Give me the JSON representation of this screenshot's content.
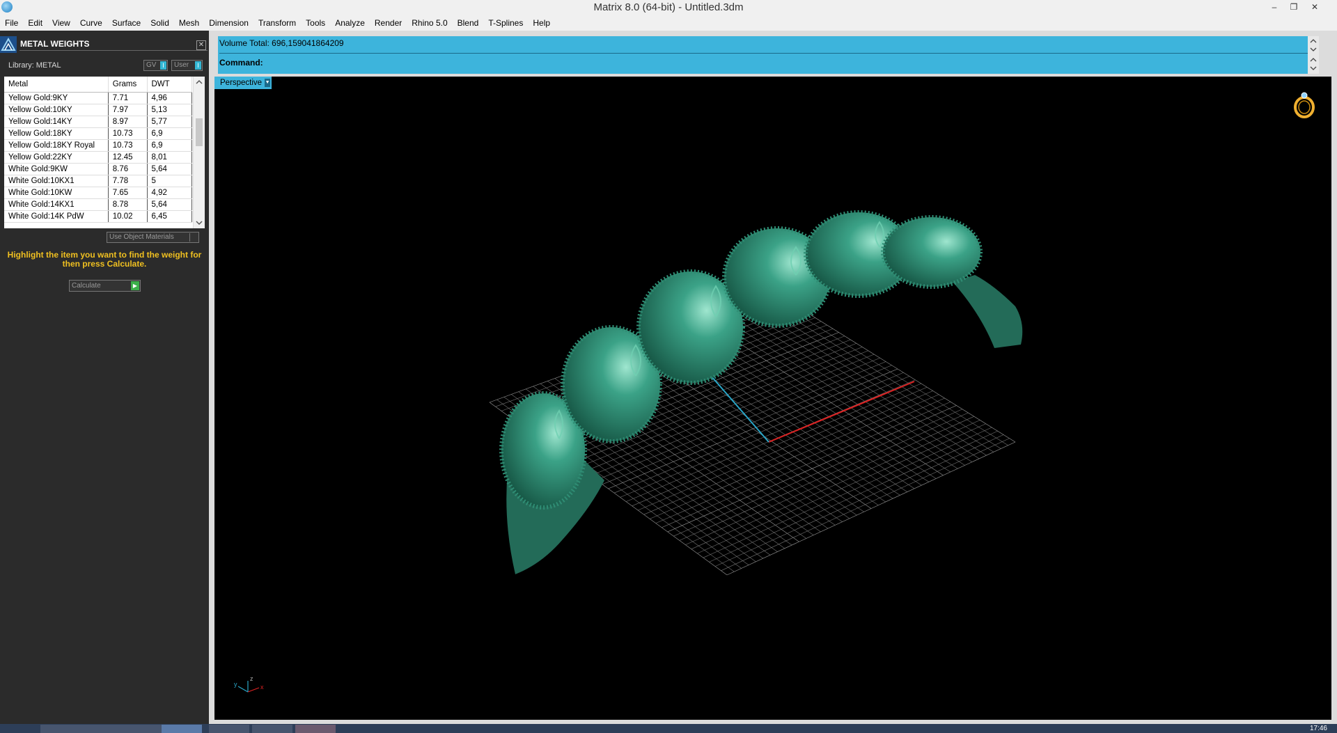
{
  "window": {
    "title": "Matrix 8.0 (64-bit) - Untitled.3dm",
    "controls": [
      "–",
      "❐",
      "✕"
    ]
  },
  "menu": [
    "File",
    "Edit",
    "View",
    "Curve",
    "Surface",
    "Solid",
    "Mesh",
    "Dimension",
    "Transform",
    "Tools",
    "Analyze",
    "Render",
    "Rhino 5.0",
    "Blend",
    "T-Splines",
    "Help"
  ],
  "panel": {
    "title": "METAL WEIGHTS",
    "close": "✕",
    "library_label": "Library: METAL",
    "gv_label": "GV",
    "user_label": "User",
    "columns": [
      "Metal",
      "Grams",
      "DWT"
    ],
    "rows": [
      [
        "Yellow Gold:9KY",
        "7.71",
        "4,96"
      ],
      [
        "Yellow Gold:10KY",
        "7.97",
        "5,13"
      ],
      [
        "Yellow Gold:14KY",
        "8.97",
        "5,77"
      ],
      [
        "Yellow Gold:18KY",
        "10.73",
        "6,9"
      ],
      [
        "Yellow Gold:18KY Royal",
        "10.73",
        "6,9"
      ],
      [
        "Yellow Gold:22KY",
        "12.45",
        "8,01"
      ],
      [
        "White Gold:9KW",
        "8.76",
        "5,64"
      ],
      [
        "White Gold:10KX1",
        "7.78",
        "5"
      ],
      [
        "White Gold:10KW",
        "7.65",
        "4,92"
      ],
      [
        "White Gold:14KX1",
        "8.78",
        "5,64"
      ],
      [
        "White Gold:14K PdW",
        "10.02",
        "6,45"
      ]
    ],
    "use_object_materials": "Use Object Materials",
    "hint": "Highlight the item you want to find the weight for then press Calculate.",
    "calculate_label": "Calculate"
  },
  "command": {
    "volume": "Volume Total: 696,159041864209",
    "prompt": "Command:"
  },
  "viewport": {
    "name": "Perspective"
  },
  "axis": {
    "y": "y",
    "z": "z",
    "x": "x"
  },
  "taskbar": {
    "clock": "17:46"
  },
  "colors": {
    "accent": "#3db4dc",
    "model": "#2e8b73",
    "hint": "#f0c020"
  }
}
